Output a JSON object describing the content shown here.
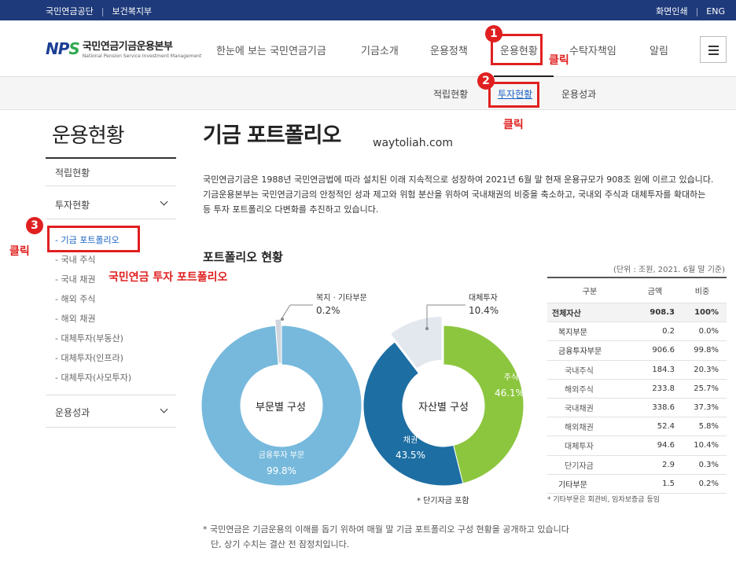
{
  "util": {
    "left": [
      "국민연금공단",
      "보건복지부"
    ],
    "right": [
      "화면인쇄",
      "ENG"
    ]
  },
  "logo": {
    "mark_n": "NP",
    "mark_s": "S",
    "name": "국민연금기금운용본부",
    "name_en": "National Pension Service Investment Management"
  },
  "gnb": [
    "한눈에 보는 국민연금기금",
    "기금소개",
    "운용정책",
    "운용현황",
    "수탁자책임",
    "알림"
  ],
  "subnav": [
    "적립현황",
    "투자현황",
    "운용성과"
  ],
  "callouts": {
    "b1": "1",
    "b2": "2",
    "b3": "3",
    "click": "클릭",
    "portfolio": "국민연금 투자 포트폴리오"
  },
  "sidebar": {
    "title": "운용현황",
    "items": [
      "적립현황",
      "투자현황",
      "운용성과"
    ],
    "subs": [
      "- 기금 포트폴리오",
      "- 국내 주식",
      "- 국내 채권",
      "- 해외 주식",
      "- 해외 채권",
      "- 대체투자(부동산)",
      "- 대체투자(인프라)",
      "- 대체투자(사모투자)"
    ]
  },
  "main": {
    "title": "기금 포트폴리오",
    "watermark": "waytoliah.com",
    "intro": "국민연금기금은 1988년 국민연금법에 따라 설치된 이래 지속적으로 성장하여 2021년 6월 말 현재 운용규모가 908조 원에 이르고 있습니다. 기금운용본부는 국민연금기금의 안정적인 성과 제고와 위험 분산을 위하여 국내채권의 비중을 축소하고, 국내외 주식과 대체투자를 확대하는 등 투자 포트폴리오 다변화를 추진하고 있습니다.",
    "section": "포트폴리오 현황",
    "unit": "(단위 : 조원, 2021. 6월 말 기준)",
    "chart_note": "* 단기자금 포함",
    "footnote1": "* 국민연금은 기금운용의 이해를 돕기 위하여 매월 말 기금 포트폴리오 구성 현황을 공개하고 있습니다",
    "footnote2": "단, 상기 수치는 결산 전 잠정치입니다."
  },
  "table": {
    "headers": [
      "구분",
      "금액",
      "비중"
    ],
    "rows": [
      {
        "name": "전체자산",
        "amount": "908.3",
        "ratio": "100%",
        "level": 0,
        "total": true
      },
      {
        "name": "복지부문",
        "amount": "0.2",
        "ratio": "0.0%",
        "level": 1
      },
      {
        "name": "금융투자부문",
        "amount": "906.6",
        "ratio": "99.8%",
        "level": 1
      },
      {
        "name": "국내주식",
        "amount": "184.3",
        "ratio": "20.3%",
        "level": 2
      },
      {
        "name": "해외주식",
        "amount": "233.8",
        "ratio": "25.7%",
        "level": 2
      },
      {
        "name": "국내채권",
        "amount": "338.6",
        "ratio": "37.3%",
        "level": 2
      },
      {
        "name": "해외채권",
        "amount": "52.4",
        "ratio": "5.8%",
        "level": 2
      },
      {
        "name": "대체투자",
        "amount": "94.6",
        "ratio": "10.4%",
        "level": 2
      },
      {
        "name": "단기자금",
        "amount": "2.9",
        "ratio": "0.3%",
        "level": 2
      },
      {
        "name": "기타부문",
        "amount": "1.5",
        "ratio": "0.2%",
        "level": 1
      }
    ],
    "note": "* 기타부문은 회관비, 임차보증금 등임"
  },
  "chart_data": [
    {
      "type": "pie",
      "title": "부문별 구성",
      "categories": [
        "금융투자 부문",
        "복지 · 기타부문"
      ],
      "values": [
        99.8,
        0.2
      ],
      "labels": [
        "99.8%",
        "0.2%"
      ],
      "colors": [
        "#76b9dc",
        "#cfd6dd"
      ]
    },
    {
      "type": "pie",
      "title": "자산별 구성",
      "categories": [
        "주식",
        "채권",
        "대체투자"
      ],
      "values": [
        46.1,
        43.5,
        10.4
      ],
      "labels": [
        "46.1%",
        "43.5%",
        "10.4%"
      ],
      "colors": [
        "#8cc63f",
        "#1d6ea3",
        "#e3e8ef"
      ]
    }
  ]
}
